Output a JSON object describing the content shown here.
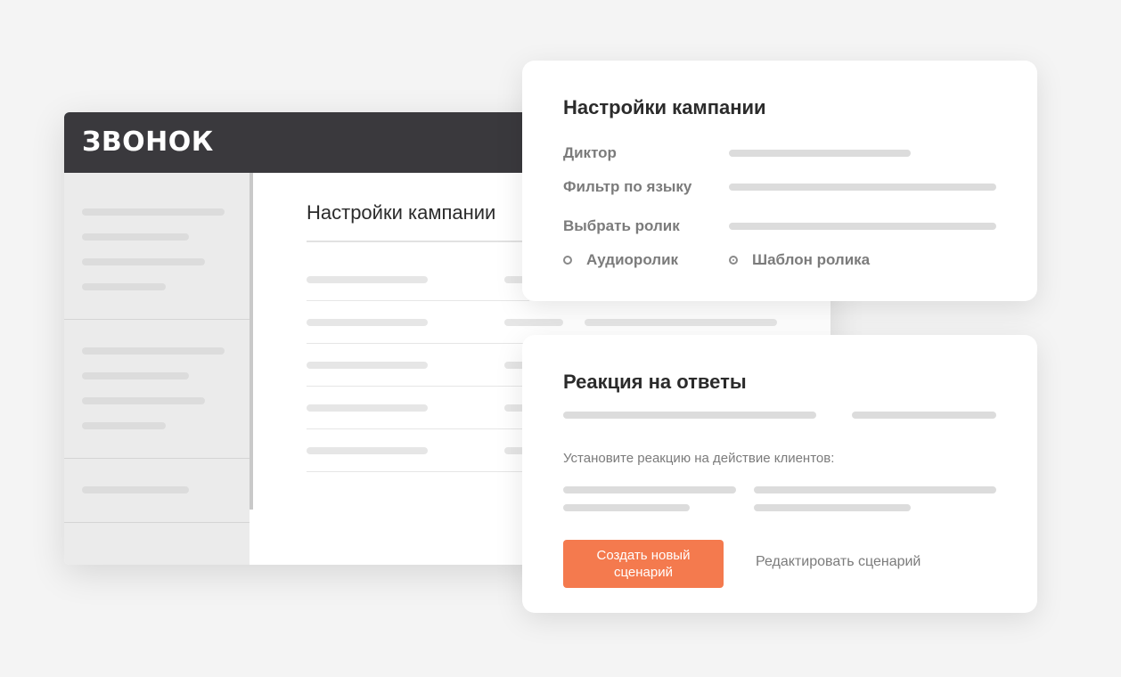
{
  "app": {
    "logo_text": "ЗВОНОК",
    "main_title": "Настройки кампании"
  },
  "campaign_settings": {
    "title": "Настройки кампании",
    "fields": {
      "speaker_label": "Диктор",
      "language_filter_label": "Фильтр по языку",
      "choose_clip_label": "Выбрать ролик"
    },
    "options": [
      {
        "label": "Аудиоролик",
        "selected": false
      },
      {
        "label": "Шаблон ролика",
        "selected": true
      }
    ]
  },
  "responses": {
    "title": "Реакция на ответы",
    "hint": "Установите реакцию на действие клиентов:",
    "primary_button": "Создать новый сценарий",
    "edit_link": "Редактировать сценарий"
  },
  "colors": {
    "header_bg": "#3a393d",
    "accent": "#f47a4e",
    "page_bg": "#f4f4f4"
  }
}
